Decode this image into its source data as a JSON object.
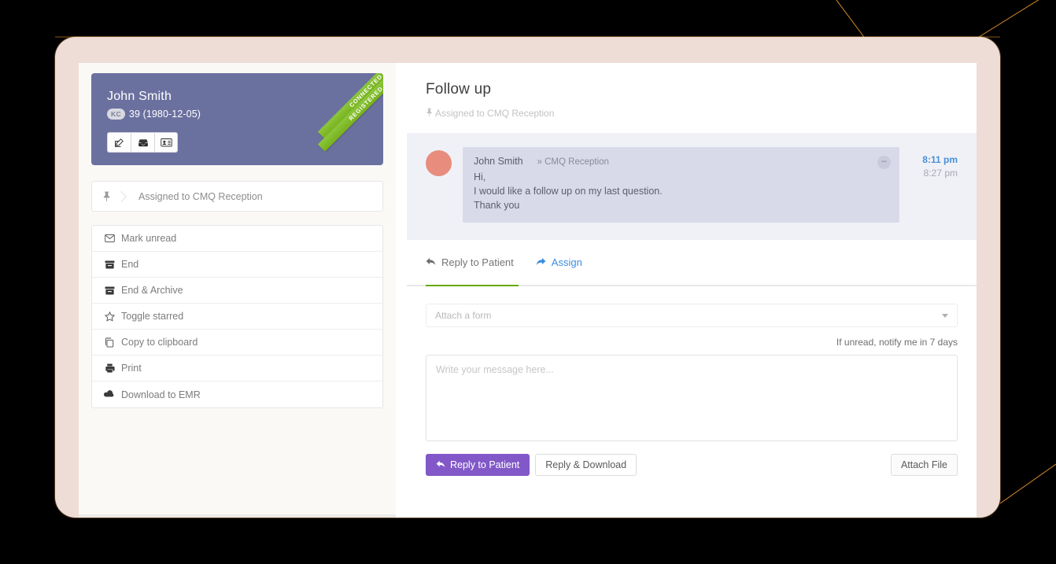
{
  "patient": {
    "name": "John Smith",
    "initials_badge": "KC",
    "age_dob": "39 (1980-12-05)",
    "ribbon_outer": "CONNECTED",
    "ribbon_inner": "REGISTERED",
    "card_color": "#6b719f",
    "ribbon_color": "#7db41a",
    "actions": [
      {
        "icon": "edit-square-icon",
        "label": "Edit patient"
      },
      {
        "icon": "inbox-icon",
        "label": "Inbox"
      },
      {
        "icon": "id-card-icon",
        "label": "Patient card"
      }
    ]
  },
  "assigned_row": {
    "icon": "pin-icon",
    "label": "Assigned to CMQ Reception"
  },
  "action_menu": [
    {
      "icon": "envelope-icon",
      "label": "Mark unread"
    },
    {
      "icon": "archive-icon",
      "label": "End"
    },
    {
      "icon": "archive-icon",
      "label": "End & Archive"
    },
    {
      "icon": "star-icon",
      "label": "Toggle starred"
    },
    {
      "icon": "copy-icon",
      "label": "Copy to clipboard"
    },
    {
      "icon": "printer-icon",
      "label": "Print"
    },
    {
      "icon": "cloud-down-icon",
      "label": "Download to EMR"
    }
  ],
  "thread": {
    "title": "Follow up",
    "assigned_icon": "pin-icon",
    "assigned_label": "Assigned to CMQ Reception"
  },
  "message": {
    "avatar_color": "#e88c7e",
    "from": "John Smith",
    "to": "» CMQ Reception",
    "lines": [
      "Hi,",
      "I would like a follow up on my last question.",
      "Thank you"
    ],
    "collapse_glyph": "–",
    "time_primary": "8:11 pm",
    "time_secondary": "8:27 pm",
    "time_primary_color": "#4a90d9"
  },
  "tabs": [
    {
      "icon": "reply-arrow-icon",
      "label": "Reply to Patient",
      "active": true,
      "color": "#757575"
    },
    {
      "icon": "forward-arrow-icon",
      "label": "Assign",
      "active": false,
      "color": "#3a8dde"
    }
  ],
  "active_tab_underline_color": "#6aa80f",
  "reply_form": {
    "attach_form_placeholder": "Attach a form",
    "caret_icon": "chevron-down-icon",
    "notify_text": "If unread, notify me in 7 days",
    "message_placeholder": "Write your message here...",
    "buttons": {
      "primary": {
        "icon": "reply-arrow-icon",
        "label": "Reply to Patient",
        "color": "#8258c8"
      },
      "secondary": {
        "label": "Reply & Download"
      },
      "attach": {
        "label": "Attach File"
      }
    }
  }
}
